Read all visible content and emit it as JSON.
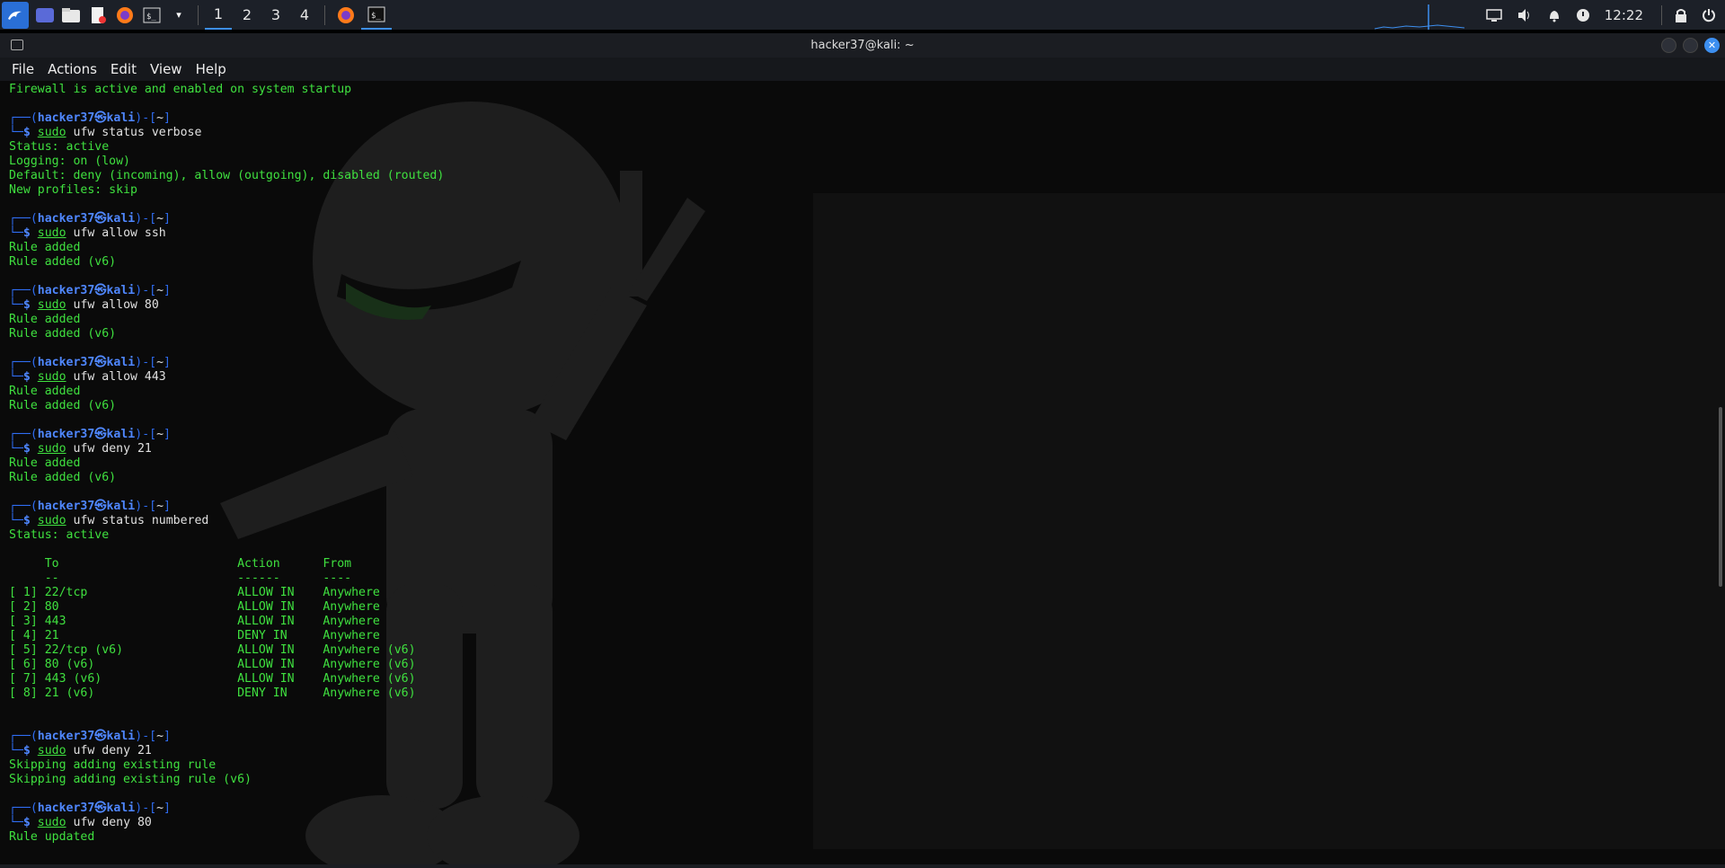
{
  "panel": {
    "workspaces": [
      "1",
      "2",
      "3",
      "4"
    ],
    "active_workspace": 0,
    "clock": "12:22"
  },
  "window": {
    "title": "hacker37@kali: ~"
  },
  "menu": [
    "File",
    "Actions",
    "Edit",
    "View",
    "Help"
  ],
  "terminal": {
    "lines": [
      {
        "type": "out",
        "text": "Firewall is active and enabled on system startup"
      },
      {
        "type": "blank"
      },
      {
        "type": "prompt1",
        "user": "hacker37",
        "host": "kali",
        "dir": "~"
      },
      {
        "type": "prompt2",
        "sudo": "sudo",
        "cmd": "ufw status verbose"
      },
      {
        "type": "out",
        "text": "Status: active"
      },
      {
        "type": "out",
        "text": "Logging: on (low)"
      },
      {
        "type": "out",
        "text": "Default: deny (incoming), allow (outgoing), disabled (routed)"
      },
      {
        "type": "out",
        "text": "New profiles: skip"
      },
      {
        "type": "blank"
      },
      {
        "type": "prompt1",
        "user": "hacker37",
        "host": "kali",
        "dir": "~"
      },
      {
        "type": "prompt2",
        "sudo": "sudo",
        "cmd": "ufw allow ssh"
      },
      {
        "type": "out",
        "text": "Rule added"
      },
      {
        "type": "out",
        "text": "Rule added (v6)"
      },
      {
        "type": "blank"
      },
      {
        "type": "prompt1",
        "user": "hacker37",
        "host": "kali",
        "dir": "~"
      },
      {
        "type": "prompt2",
        "sudo": "sudo",
        "cmd": "ufw allow 80"
      },
      {
        "type": "out",
        "text": "Rule added"
      },
      {
        "type": "out",
        "text": "Rule added (v6)"
      },
      {
        "type": "blank"
      },
      {
        "type": "prompt1",
        "user": "hacker37",
        "host": "kali",
        "dir": "~"
      },
      {
        "type": "prompt2",
        "sudo": "sudo",
        "cmd": "ufw allow 443"
      },
      {
        "type": "out",
        "text": "Rule added"
      },
      {
        "type": "out",
        "text": "Rule added (v6)"
      },
      {
        "type": "blank"
      },
      {
        "type": "prompt1",
        "user": "hacker37",
        "host": "kali",
        "dir": "~"
      },
      {
        "type": "prompt2",
        "sudo": "sudo",
        "cmd": "ufw deny 21"
      },
      {
        "type": "out",
        "text": "Rule added"
      },
      {
        "type": "out",
        "text": "Rule added (v6)"
      },
      {
        "type": "blank"
      },
      {
        "type": "prompt1",
        "user": "hacker37",
        "host": "kali",
        "dir": "~"
      },
      {
        "type": "prompt2",
        "sudo": "sudo",
        "cmd": "ufw status numbered"
      },
      {
        "type": "out",
        "text": "Status: active"
      },
      {
        "type": "blank"
      },
      {
        "type": "out",
        "text": "     To                         Action      From"
      },
      {
        "type": "out",
        "text": "     --                         ------      ----"
      },
      {
        "type": "out",
        "text": "[ 1] 22/tcp                     ALLOW IN    Anywhere"
      },
      {
        "type": "out",
        "text": "[ 2] 80                         ALLOW IN    Anywhere"
      },
      {
        "type": "out",
        "text": "[ 3] 443                        ALLOW IN    Anywhere"
      },
      {
        "type": "out",
        "text": "[ 4] 21                         DENY IN     Anywhere"
      },
      {
        "type": "out",
        "text": "[ 5] 22/tcp (v6)                ALLOW IN    Anywhere (v6)"
      },
      {
        "type": "out",
        "text": "[ 6] 80 (v6)                    ALLOW IN    Anywhere (v6)"
      },
      {
        "type": "out",
        "text": "[ 7] 443 (v6)                   ALLOW IN    Anywhere (v6)"
      },
      {
        "type": "out",
        "text": "[ 8] 21 (v6)                    DENY IN     Anywhere (v6)"
      },
      {
        "type": "blank"
      },
      {
        "type": "blank"
      },
      {
        "type": "prompt1",
        "user": "hacker37",
        "host": "kali",
        "dir": "~"
      },
      {
        "type": "prompt2",
        "sudo": "sudo",
        "cmd": "ufw deny 21"
      },
      {
        "type": "out",
        "text": "Skipping adding existing rule"
      },
      {
        "type": "out",
        "text": "Skipping adding existing rule (v6)"
      },
      {
        "type": "blank"
      },
      {
        "type": "prompt1",
        "user": "hacker37",
        "host": "kali",
        "dir": "~"
      },
      {
        "type": "prompt2",
        "sudo": "sudo",
        "cmd": "ufw deny 80"
      },
      {
        "type": "out",
        "text": "Rule updated"
      }
    ]
  },
  "colors": {
    "output": "#3fe03f",
    "prompt_frame": "#2f6df2",
    "prompt_user": "#4f87ff",
    "accent": "#3d8ff0"
  }
}
